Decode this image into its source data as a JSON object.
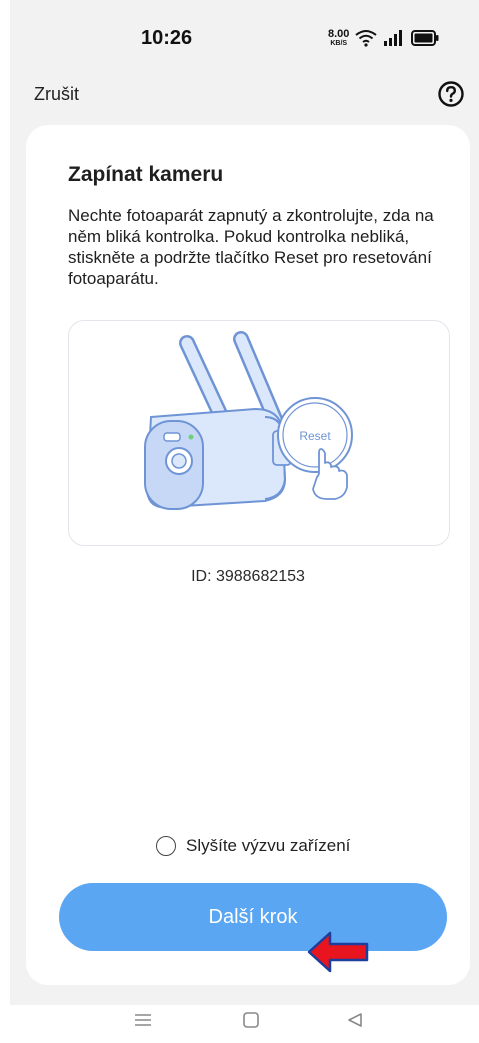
{
  "status_bar": {
    "time": "10:26",
    "net_speed_value": "8.00",
    "net_speed_unit": "KB/S"
  },
  "header": {
    "cancel_label": "Zrušit"
  },
  "card": {
    "title": "Zapínat kameru",
    "description": "Nechte fotoaparát zapnutý a zkontrolujte, zda na něm bliká kontrolka. Pokud kontrolka nebliká, stiskněte a podržte tlačítko Reset pro resetování fotoaparátu.",
    "illustration_reset_label": "Reset",
    "device_id": "ID: 3988682153",
    "prompt_checkbox_label": "Slyšíte výzvu zařízení",
    "next_button_label": "Další krok"
  },
  "colors": {
    "primary_button": "#5aa6f2",
    "annotation_arrow": "#e8141e",
    "illustration_stroke": "#6f94d6",
    "illustration_fill": "#dbe8fb"
  },
  "icons": [
    "help-icon",
    "wifi-icon",
    "signal-icon",
    "battery-icon",
    "menu-icon",
    "home-icon",
    "back-icon",
    "red-arrow-icon"
  ]
}
